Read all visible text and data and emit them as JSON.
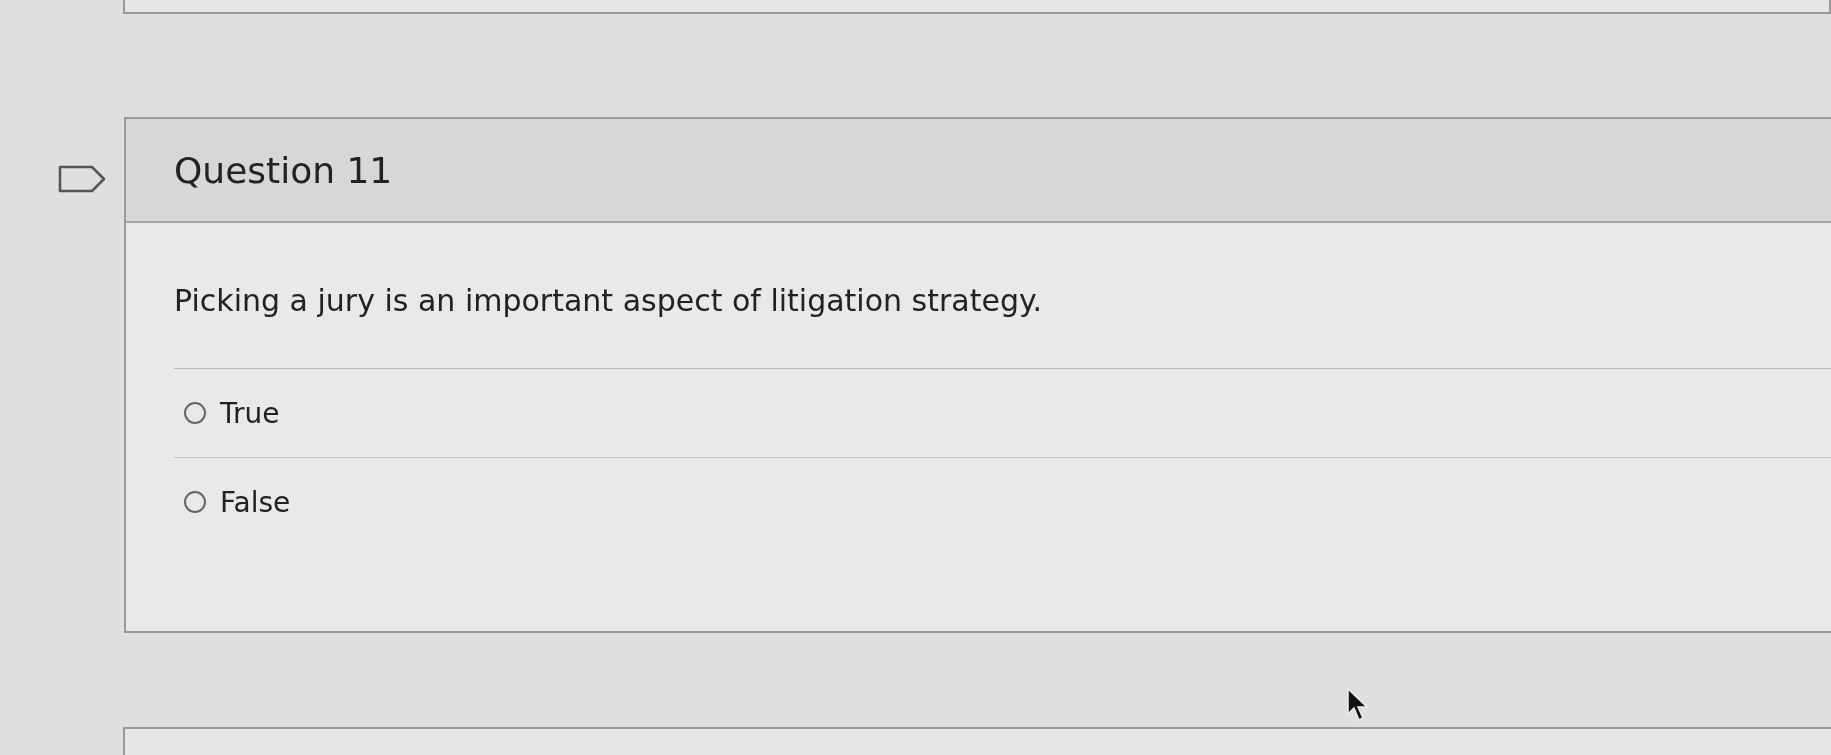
{
  "question": {
    "title": "Question 11",
    "text": "Picking a jury is an important aspect of litigation strategy.",
    "options": [
      {
        "label": "True",
        "selected": false
      },
      {
        "label": "False",
        "selected": false
      }
    ]
  }
}
